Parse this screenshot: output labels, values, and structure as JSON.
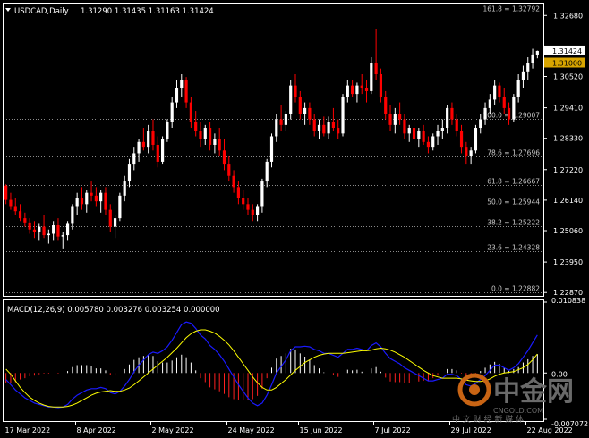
{
  "chart_data": [
    {
      "type": "candlestick",
      "title": "USDCAD,Daily",
      "ohlc_header": "1.31290 1.31435 1.31163 1.31424",
      "x_tick_labels": [
        "17 Mar 2022",
        "8 Apr 2022",
        "2 May 2022",
        "24 May 2022",
        "15 Jun 2022",
        "7 Jul 2022",
        "29 Jul 2022",
        "22 Aug 2022"
      ],
      "y_ticks": [
        1.3268,
        1.3052,
        1.2941,
        1.2833,
        1.2722,
        1.2614,
        1.2506,
        1.2395,
        1.2287
      ],
      "y_tick_labels": [
        "1.32680",
        "1.30520",
        "1.29410",
        "1.28330",
        "1.27220",
        "1.26140",
        "1.25060",
        "1.23950",
        "1.22870"
      ],
      "ylim": [
        1.2275,
        1.331
      ],
      "current_price_label": "1.31424",
      "current_price": 1.31424,
      "horizontal_line_label": "1.31000",
      "horizontal_line": 1.31,
      "fibonacci_levels": [
        {
          "label": "161.8 = 1.32792",
          "value": 1.32792
        },
        {
          "label": "100.0 = 1.29007",
          "value": 1.29007
        },
        {
          "label": "78.6 = 1.27696",
          "value": 1.27696
        },
        {
          "label": "61.8 = 1.26667",
          "value": 1.26667
        },
        {
          "label": "50.0 = 1.25944",
          "value": 1.25944
        },
        {
          "label": "38.2 = 1.25222",
          "value": 1.25222
        },
        {
          "label": "23.6 = 1.24328",
          "value": 1.24328
        },
        {
          "label": "0.0 = 1.22882",
          "value": 1.22882
        }
      ],
      "candles": [
        [
          1.2665,
          1.267,
          1.26,
          1.2615
        ],
        [
          1.2615,
          1.264,
          1.258,
          1.259
        ],
        [
          1.259,
          1.262,
          1.256,
          1.2575
        ],
        [
          1.2575,
          1.26,
          1.254,
          1.255
        ],
        [
          1.255,
          1.257,
          1.252,
          1.2535
        ],
        [
          1.2535,
          1.255,
          1.2495,
          1.251
        ],
        [
          1.251,
          1.254,
          1.248,
          1.25
        ],
        [
          1.25,
          1.253,
          1.247,
          1.252
        ],
        [
          1.252,
          1.256,
          1.248,
          1.249
        ],
        [
          1.249,
          1.251,
          1.246,
          1.2495
        ],
        [
          1.2495,
          1.254,
          1.247,
          1.2525
        ],
        [
          1.2525,
          1.255,
          1.247,
          1.2485
        ],
        [
          1.2485,
          1.25,
          1.244,
          1.249
        ],
        [
          1.249,
          1.254,
          1.247,
          1.253
        ],
        [
          1.253,
          1.26,
          1.251,
          1.259
        ],
        [
          1.259,
          1.264,
          1.256,
          1.262
        ],
        [
          1.262,
          1.266,
          1.258,
          1.26
        ],
        [
          1.26,
          1.265,
          1.257,
          1.264
        ],
        [
          1.264,
          1.268,
          1.261,
          1.263
        ],
        [
          1.263,
          1.266,
          1.259,
          1.261
        ],
        [
          1.261,
          1.265,
          1.257,
          1.264
        ],
        [
          1.264,
          1.266,
          1.256,
          1.258
        ],
        [
          1.258,
          1.26,
          1.25,
          1.252
        ],
        [
          1.252,
          1.256,
          1.248,
          1.255
        ],
        [
          1.255,
          1.264,
          1.254,
          1.263
        ],
        [
          1.263,
          1.27,
          1.261,
          1.268
        ],
        [
          1.268,
          1.276,
          1.266,
          1.274
        ],
        [
          1.274,
          1.28,
          1.272,
          1.278
        ],
        [
          1.278,
          1.283,
          1.275,
          1.282
        ],
        [
          1.282,
          1.287,
          1.279,
          1.28
        ],
        [
          1.28,
          1.288,
          1.278,
          1.286
        ],
        [
          1.286,
          1.29,
          1.279,
          1.281
        ],
        [
          1.281,
          1.284,
          1.273,
          1.275
        ],
        [
          1.275,
          1.284,
          1.274,
          1.283
        ],
        [
          1.283,
          1.29,
          1.282,
          1.289
        ],
        [
          1.289,
          1.298,
          1.287,
          1.296
        ],
        [
          1.296,
          1.304,
          1.294,
          1.301
        ],
        [
          1.301,
          1.306,
          1.298,
          1.304
        ],
        [
          1.304,
          1.305,
          1.294,
          1.296
        ],
        [
          1.296,
          1.298,
          1.287,
          1.289
        ],
        [
          1.289,
          1.293,
          1.284,
          1.286
        ],
        [
          1.286,
          1.289,
          1.28,
          1.283
        ],
        [
          1.283,
          1.288,
          1.281,
          1.287
        ],
        [
          1.287,
          1.289,
          1.279,
          1.281
        ],
        [
          1.281,
          1.285,
          1.278,
          1.283
        ],
        [
          1.283,
          1.287,
          1.277,
          1.279
        ],
        [
          1.279,
          1.283,
          1.272,
          1.274
        ],
        [
          1.274,
          1.277,
          1.268,
          1.27
        ],
        [
          1.27,
          1.272,
          1.264,
          1.266
        ],
        [
          1.266,
          1.268,
          1.26,
          1.262
        ],
        [
          1.262,
          1.265,
          1.258,
          1.26
        ],
        [
          1.26,
          1.262,
          1.256,
          1.258
        ],
        [
          1.258,
          1.26,
          1.254,
          1.256
        ],
        [
          1.256,
          1.26,
          1.254,
          1.259
        ],
        [
          1.259,
          1.269,
          1.257,
          1.268
        ],
        [
          1.268,
          1.276,
          1.266,
          1.275
        ],
        [
          1.275,
          1.285,
          1.273,
          1.284
        ],
        [
          1.284,
          1.292,
          1.282,
          1.29
        ],
        [
          1.29,
          1.295,
          1.286,
          1.288
        ],
        [
          1.288,
          1.293,
          1.286,
          1.292
        ],
        [
          1.292,
          1.304,
          1.29,
          1.302
        ],
        [
          1.302,
          1.306,
          1.296,
          1.298
        ],
        [
          1.298,
          1.3,
          1.29,
          1.292
        ],
        [
          1.292,
          1.296,
          1.288,
          1.294
        ],
        [
          1.294,
          1.296,
          1.288,
          1.29
        ],
        [
          1.29,
          1.292,
          1.284,
          1.286
        ],
        [
          1.286,
          1.29,
          1.283,
          1.288
        ],
        [
          1.288,
          1.291,
          1.284,
          1.285
        ],
        [
          1.285,
          1.291,
          1.283,
          1.289
        ],
        [
          1.289,
          1.294,
          1.286,
          1.287
        ],
        [
          1.287,
          1.29,
          1.283,
          1.285
        ],
        [
          1.285,
          1.299,
          1.284,
          1.298
        ],
        [
          1.298,
          1.304,
          1.296,
          1.302
        ],
        [
          1.302,
          1.304,
          1.298,
          1.299
        ],
        [
          1.299,
          1.303,
          1.296,
          1.302
        ],
        [
          1.302,
          1.306,
          1.299,
          1.301
        ],
        [
          1.301,
          1.304,
          1.296,
          1.3
        ],
        [
          1.3,
          1.312,
          1.299,
          1.31
        ],
        [
          1.31,
          1.322,
          1.304,
          1.306
        ],
        [
          1.306,
          1.308,
          1.296,
          1.298
        ],
        [
          1.298,
          1.3,
          1.29,
          1.292
        ],
        [
          1.292,
          1.295,
          1.286,
          1.288
        ],
        [
          1.288,
          1.294,
          1.285,
          1.292
        ],
        [
          1.292,
          1.296,
          1.288,
          1.29
        ],
        [
          1.29,
          1.292,
          1.283,
          1.285
        ],
        [
          1.285,
          1.288,
          1.282,
          1.287
        ],
        [
          1.287,
          1.289,
          1.281,
          1.283
        ],
        [
          1.283,
          1.287,
          1.28,
          1.286
        ],
        [
          1.286,
          1.288,
          1.281,
          1.282
        ],
        [
          1.282,
          1.284,
          1.278,
          1.28
        ],
        [
          1.28,
          1.285,
          1.279,
          1.284
        ],
        [
          1.284,
          1.288,
          1.281,
          1.286
        ],
        [
          1.286,
          1.29,
          1.283,
          1.287
        ],
        [
          1.287,
          1.295,
          1.285,
          1.294
        ],
        [
          1.294,
          1.296,
          1.288,
          1.29
        ],
        [
          1.29,
          1.292,
          1.284,
          1.286
        ],
        [
          1.286,
          1.288,
          1.278,
          1.28
        ],
        [
          1.28,
          1.282,
          1.274,
          1.277
        ],
        [
          1.277,
          1.28,
          1.274,
          1.279
        ],
        [
          1.279,
          1.288,
          1.278,
          1.287
        ],
        [
          1.287,
          1.292,
          1.285,
          1.29
        ],
        [
          1.29,
          1.296,
          1.288,
          1.294
        ],
        [
          1.294,
          1.299,
          1.292,
          1.297
        ],
        [
          1.297,
          1.304,
          1.295,
          1.302
        ],
        [
          1.302,
          1.303,
          1.296,
          1.298
        ],
        [
          1.298,
          1.301,
          1.292,
          1.294
        ],
        [
          1.294,
          1.296,
          1.288,
          1.29
        ],
        [
          1.29,
          1.299,
          1.289,
          1.298
        ],
        [
          1.298,
          1.306,
          1.296,
          1.304
        ],
        [
          1.304,
          1.309,
          1.301,
          1.307
        ],
        [
          1.307,
          1.312,
          1.304,
          1.31
        ],
        [
          1.31,
          1.315,
          1.308,
          1.313
        ],
        [
          1.3129,
          1.31435,
          1.31163,
          1.31424
        ]
      ]
    },
    {
      "type": "bar",
      "title": "MACD(12,26,9) 0.005780 0.003276 0.003254 0.000000",
      "y_tick_labels": [
        "0.010838",
        "0.00",
        "-0.007072"
      ],
      "ylim": [
        -0.007072,
        0.010838
      ],
      "series": [
        {
          "name": "MACD",
          "values": [
            -0.001,
            -0.0018,
            -0.0026,
            -0.0032,
            -0.0038,
            -0.0042,
            -0.0046,
            -0.0048,
            -0.005,
            -0.0052,
            -0.0052,
            -0.0053,
            -0.0052,
            -0.0048,
            -0.004,
            -0.0034,
            -0.003,
            -0.0026,
            -0.0024,
            -0.0024,
            -0.0022,
            -0.0024,
            -0.003,
            -0.0032,
            -0.0028,
            -0.002,
            -0.001,
            0.0002,
            0.0012,
            0.002,
            0.0028,
            0.0032,
            0.003,
            0.0034,
            0.004,
            0.005,
            0.0062,
            0.0074,
            0.0078,
            0.0076,
            0.0068,
            0.0058,
            0.0052,
            0.0042,
            0.0036,
            0.0028,
            0.0018,
            0.0006,
            -0.0006,
            -0.0018,
            -0.0028,
            -0.0038,
            -0.0046,
            -0.005,
            -0.0046,
            -0.0034,
            -0.0018,
            0.0,
            0.001,
            0.002,
            0.0034,
            0.004,
            0.004,
            0.0041,
            0.004,
            0.0036,
            0.0034,
            0.003,
            0.003,
            0.0027,
            0.0024,
            0.003,
            0.0036,
            0.0036,
            0.0038,
            0.0036,
            0.0034,
            0.0042,
            0.0046,
            0.004,
            0.003,
            0.0022,
            0.0018,
            0.0014,
            0.0008,
            0.0004,
            0.0,
            -0.0004,
            -0.0008,
            -0.0012,
            -0.0012,
            -0.001,
            -0.0008,
            -0.0002,
            -0.0002,
            -0.0004,
            -0.001,
            -0.0018,
            -0.002,
            -0.0016,
            -0.001,
            -0.0004,
            0.0004,
            0.0012,
            0.0012,
            0.0008,
            0.0004,
            0.0008,
            0.0014,
            0.0024,
            0.0034,
            0.0046,
            0.0058
          ]
        },
        {
          "name": "Signal",
          "values": [
            0.0006,
            -0.0002,
            -0.0012,
            -0.0022,
            -0.003,
            -0.0037,
            -0.0042,
            -0.0046,
            -0.0049,
            -0.0051,
            -0.0052,
            -0.0052,
            -0.0052,
            -0.0051,
            -0.0049,
            -0.0046,
            -0.0042,
            -0.0038,
            -0.0034,
            -0.0031,
            -0.0029,
            -0.0028,
            -0.0027,
            -0.0028,
            -0.0028,
            -0.0026,
            -0.0023,
            -0.0018,
            -0.0012,
            -0.0006,
            0.0,
            0.0006,
            0.0012,
            0.0018,
            0.0024,
            0.0031,
            0.0038,
            0.0046,
            0.0054,
            0.006,
            0.0064,
            0.0066,
            0.0066,
            0.0064,
            0.0061,
            0.0056,
            0.005,
            0.0043,
            0.0034,
            0.0024,
            0.0014,
            0.0004,
            -0.0006,
            -0.0015,
            -0.0022,
            -0.0026,
            -0.0026,
            -0.0022,
            -0.0016,
            -0.001,
            -0.0003,
            0.0004,
            0.001,
            0.0016,
            0.002,
            0.0024,
            0.0027,
            0.0029,
            0.003,
            0.003,
            0.003,
            0.003,
            0.0031,
            0.0032,
            0.0033,
            0.0034,
            0.0034,
            0.0035,
            0.0037,
            0.0038,
            0.0037,
            0.0035,
            0.0032,
            0.0028,
            0.0024,
            0.0019,
            0.0014,
            0.0009,
            0.0004,
            0.0,
            -0.0004,
            -0.0006,
            -0.0008,
            -0.0008,
            -0.0008,
            -0.0008,
            -0.0009,
            -0.0011,
            -0.0012,
            -0.0013,
            -0.0013,
            -0.0012,
            -0.0009,
            -0.0005,
            -0.0002,
            0.0,
            0.0001,
            0.0002,
            0.0005,
            0.0008,
            0.0013,
            0.002,
            0.0029
          ]
        },
        {
          "name": "OsMA",
          "values": [
            -0.0016,
            -0.0016,
            -0.0014,
            -0.001,
            -0.0008,
            -0.0005,
            -0.0004,
            -0.0002,
            -0.0001,
            -0.0001,
            0.0,
            -0.0001,
            0.0,
            0.0003,
            0.0009,
            0.0012,
            0.0012,
            0.0012,
            0.001,
            0.0007,
            0.0007,
            0.0004,
            -0.0003,
            -0.0004,
            0.0,
            0.0006,
            0.0013,
            0.002,
            0.0024,
            0.0026,
            0.0028,
            0.0026,
            0.0018,
            0.0016,
            0.0016,
            0.0019,
            0.0024,
            0.0028,
            0.0024,
            0.0016,
            0.0004,
            -0.0008,
            -0.0014,
            -0.0022,
            -0.0025,
            -0.0028,
            -0.0032,
            -0.0037,
            -0.004,
            -0.0042,
            -0.0042,
            -0.0042,
            -0.004,
            -0.0035,
            -0.0024,
            -0.0008,
            0.0008,
            0.0022,
            0.0026,
            0.003,
            0.0037,
            0.0036,
            0.003,
            0.0025,
            0.002,
            0.0012,
            0.0007,
            0.0001,
            0.0,
            -0.0003,
            -0.0006,
            0.0,
            0.0005,
            0.0004,
            0.0005,
            0.0002,
            0.0,
            0.0007,
            0.0009,
            0.0002,
            -0.0007,
            -0.0013,
            -0.0014,
            -0.0014,
            -0.0016,
            -0.0015,
            -0.0014,
            -0.0013,
            -0.0012,
            -0.0012,
            -0.0008,
            -0.0004,
            0.0,
            0.0006,
            0.0006,
            0.0004,
            -0.0001,
            -0.0007,
            -0.0008,
            -0.0003,
            0.0003,
            0.0008,
            0.0013,
            0.0017,
            0.0014,
            0.0008,
            0.0003,
            0.0006,
            0.0009,
            0.0016,
            0.0021,
            0.0026,
            0.0029
          ]
        }
      ]
    }
  ],
  "watermark": {
    "brand": "中金网",
    "site": "CNGOLD.COM",
    "tagline": "中 文 财 经 新 媒 体"
  },
  "colors": {
    "background": "#000000",
    "foreground": "#ffffff",
    "bear": "#ff0000",
    "bull": "#ffffff",
    "grid": "#8a8a8a",
    "macd_line": "#1a1aff",
    "signal_line": "#ffff00",
    "osma_pos": "#ffffff",
    "osma_neg": "#ff2020",
    "price_label_bg": "#ffffff",
    "price_label_fg": "#000000",
    "hline": "#d8a500",
    "watermark": "#5a5a5a"
  }
}
